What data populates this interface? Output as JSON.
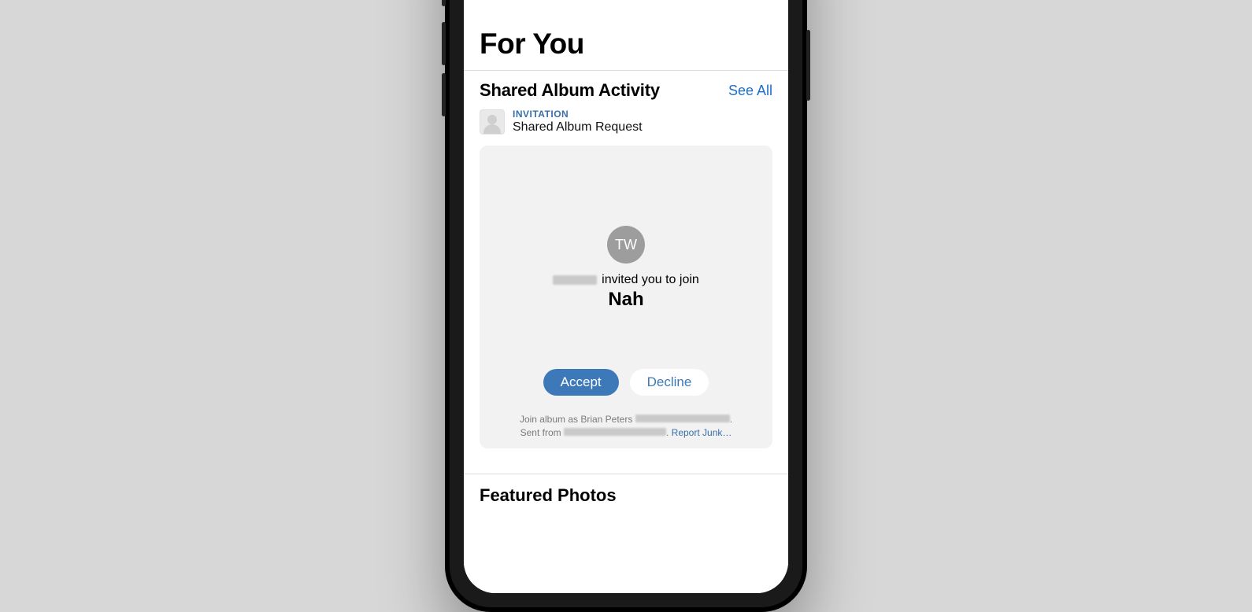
{
  "page": {
    "title": "For You"
  },
  "shared": {
    "header": "Shared Album Activity",
    "see_all": "See All",
    "eyebrow": "INVITATION",
    "request_label": "Shared Album Request"
  },
  "card": {
    "avatar_initials": "TW",
    "invite_suffix": "invited you to join",
    "album_name": "Nah",
    "accept": "Accept",
    "decline": "Decline",
    "join_prefix": "Join album as Brian Peters",
    "join_suffix": ".",
    "sent_prefix": "Sent from",
    "sent_suffix": ".",
    "report": "Report Junk…"
  },
  "featured": {
    "header": "Featured Photos"
  }
}
